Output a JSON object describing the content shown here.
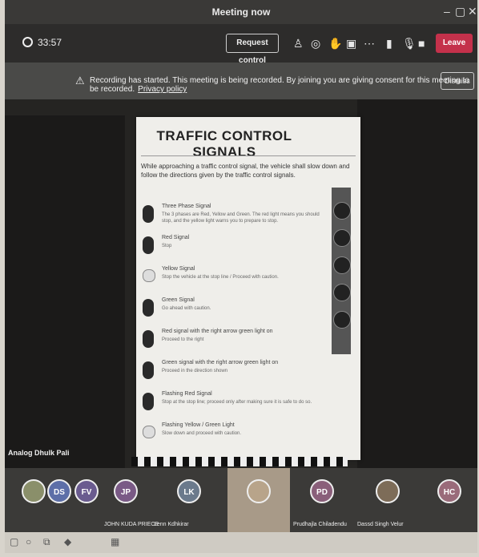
{
  "window": {
    "title": "Meeting now"
  },
  "toolbar": {
    "timer": "33:57",
    "request_control_label": "Request control",
    "leave_label": "Leave"
  },
  "banner": {
    "message": "Recording has started. This meeting is being recorded. By joining you are giving consent for this meeting to be recorded.",
    "privacy_link": "Privacy policy",
    "dismiss_label": "Dismiss"
  },
  "presenter": {
    "name": "Analog Dhulk Pali"
  },
  "document": {
    "heading": "TRAFFIC CONTROL SIGNALS",
    "intro": "While approaching a traffic control signal, the vehicle shall slow down and follow the directions given by the traffic control signals.",
    "signals": [
      {
        "label": "Three Phase Signal",
        "desc": "The 3 phases are Red, Yellow and Green. The red light means you should stop, and the yellow light warns you to prepare to stop."
      },
      {
        "label": "Red Signal",
        "desc": "Stop"
      },
      {
        "label": "Yellow Signal",
        "desc": "Stop the vehicle at the stop line / Proceed with caution."
      },
      {
        "label": "Green Signal",
        "desc": "Go ahead with caution."
      },
      {
        "label": "Red signal with the right arrow green light on",
        "desc": "Proceed to the right"
      },
      {
        "label": "Green signal with the right arrow green light on",
        "desc": "Proceed in the direction shown"
      },
      {
        "label": "Flashing Red Signal",
        "desc": "Stop at the stop line; proceed only after making sure it is safe to do so."
      },
      {
        "label": "Flashing Yellow / Green Light",
        "desc": "Slow down and proceed with caution."
      }
    ]
  },
  "participants": [
    {
      "initials": "",
      "name": "",
      "color": "#8a8f6a"
    },
    {
      "initials": "DS",
      "name": "",
      "color": "#5d6fa8"
    },
    {
      "initials": "FV",
      "name": "",
      "color": "#6a5b8f"
    },
    {
      "initials": "JP",
      "name": "JOHN KUDA PRIECE",
      "color": "#7a5a86"
    },
    {
      "initials": "LK",
      "name": "Lenn Kdhkirar",
      "color": "#6b7a8c"
    },
    {
      "initials": "",
      "name": "",
      "color": "#b8a48a"
    },
    {
      "initials": "PD",
      "name": "Prudhajla Chiladendu",
      "color": "#8a5f7a"
    },
    {
      "initials": "",
      "name": "Dassd Singh Velur",
      "color": "#7d6c58"
    },
    {
      "initials": "HC",
      "name": "",
      "color": "#9a6b7a"
    }
  ],
  "colors": {
    "leave": "#c4314b",
    "toolbar": "#2d2c2b"
  }
}
